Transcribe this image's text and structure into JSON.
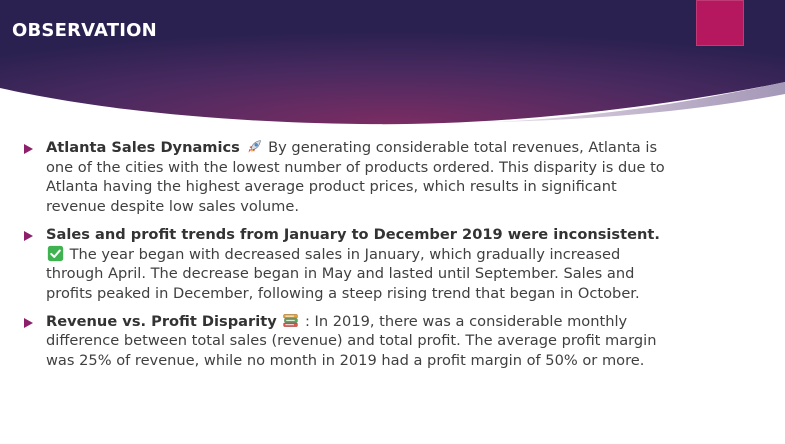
{
  "slide": {
    "title": "OBSERVATION",
    "colors": {
      "header_dark": "#2a2150",
      "header_purple": "#6b2a5e",
      "accent_square": "#b5185e",
      "bullet_marker": "#8e1f6c",
      "body_text": "#404040"
    }
  },
  "bullets": [
    {
      "heading": "Atlanta Sales Dynamics",
      "icon": "rocket-icon",
      "text": " By generating considerable total revenues, Atlanta is one of the cities with the lowest number of products ordered. This disparity is due to Atlanta having the highest average product prices, which results in significant revenue despite low sales volume."
    },
    {
      "heading": "Sales and profit trends from January to December 2019 were inconsistent.",
      "icon": "check-mark-icon",
      "text": " The year began with decreased sales in January, which gradually increased through April. The decrease began in May and lasted until September. Sales and profits peaked in December, following a steep rising trend that began in October."
    },
    {
      "heading": "Revenue vs. Profit Disparity",
      "icon": "books-icon",
      "text": " : In 2019, there was a considerable monthly difference between total sales (revenue) and total profit. The average profit margin was 25% of revenue, while no month in 2019 had a profit margin of 50% or more."
    }
  ]
}
